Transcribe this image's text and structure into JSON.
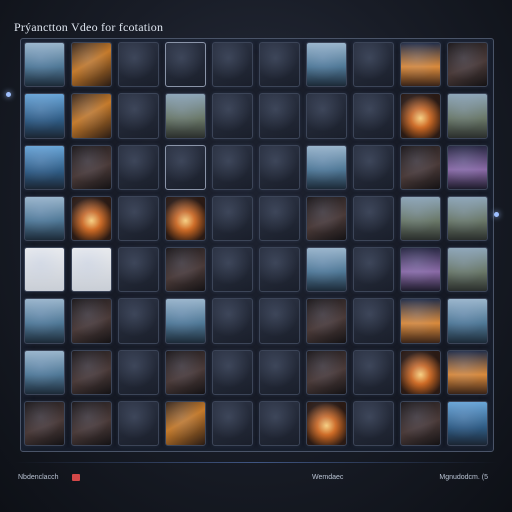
{
  "header": {
    "title": "Prýanctton Vdeo for fcotation"
  },
  "gallery": {
    "tiles": [
      "ocean",
      "warm",
      "",
      "bright",
      "",
      "",
      "ocean",
      "",
      "sunset",
      "dark",
      "sky",
      "warm",
      "",
      "land",
      "",
      "",
      "",
      "",
      "fire",
      "land",
      "sky",
      "dark",
      "",
      "bright",
      "",
      "",
      "ocean",
      "",
      "dark",
      "purple",
      "ocean",
      "fire",
      "",
      "fire",
      "",
      "",
      "dark",
      "",
      "land",
      "land",
      "doc",
      "doc",
      "",
      "dark",
      "",
      "",
      "ocean",
      "",
      "purple",
      "land",
      "ocean",
      "dark",
      "",
      "ocean",
      "",
      "",
      "dark",
      "",
      "sunset",
      "ocean",
      "ocean",
      "dark",
      "",
      "dark",
      "",
      "",
      "dark",
      "",
      "fire",
      "sunset",
      "dark",
      "dark",
      "",
      "warm",
      "",
      "",
      "fire",
      "",
      "dark",
      "sky"
    ]
  },
  "footer": {
    "left_label": "Nbdenclacch",
    "mid_label": "Wemdaec",
    "right_label": "Mgnudodcm. (5"
  },
  "colors": {
    "accent_red": "#d34848",
    "frame": "#4a5468"
  }
}
